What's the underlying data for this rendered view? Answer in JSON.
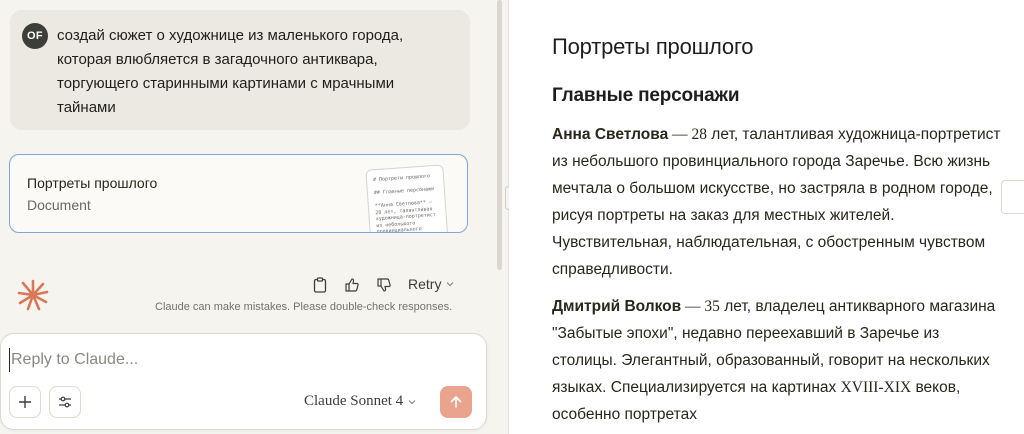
{
  "chat": {
    "user_initials": "OF",
    "user_message": "создай сюжет о художнице из маленького города, которая влюбляется в загадочного антиквара, торгующего старинными картинами с мрачными тайнами",
    "document_card": {
      "title": "Портреты прошлого",
      "type": "Document",
      "thumbnail_text": "# Портреты прошлого\n\n## Главные персонажи\n\n**Анна Светлова** — 28 лет, талантливая художница-портретист из небольшого провинциального города Заречье..."
    },
    "actions": {
      "copy_icon": "clipboard-icon",
      "thumbs_up_icon": "thumbs-up-icon",
      "thumbs_down_icon": "thumbs-down-icon",
      "retry_label": "Retry"
    },
    "disclaimer": "Claude can make mistakes. Please double-check responses."
  },
  "composer": {
    "placeholder": "Reply to Claude...",
    "model_label": "Claude Sonnet 4",
    "send_color": "#e8a48c"
  },
  "artifact": {
    "title": "Портреты прошлого",
    "section_heading": "Главные персонажи",
    "characters": [
      {
        "name": "Анна Светлова",
        "dash": " — ",
        "age": "28",
        "description": " лет, талантливая художница-портретист из небольшого провинциального города Заречье. Всю жизнь мечтала о большом искусстве, но застряла в родном городе, рисуя портреты на заказ для местных жителей. Чувствительная, наблюдательная, с обостренным чувством справедливости."
      },
      {
        "name": "Дмитрий Волков",
        "dash": " — ",
        "age": "35",
        "description_1": " лет, владелец антикварного магазина \"Забытые эпохи\", недавно переехавший в Заречье из столицы. Элегантный, образованный, говорит на нескольких языках. Специализируется на картинах ",
        "centuries": "XVIII-XIX",
        "description_2": " веков, особенно портретах"
      }
    ]
  },
  "colors": {
    "accent": "#d97757",
    "card_border": "#7ea6d8",
    "background": "#f5f4ef"
  }
}
